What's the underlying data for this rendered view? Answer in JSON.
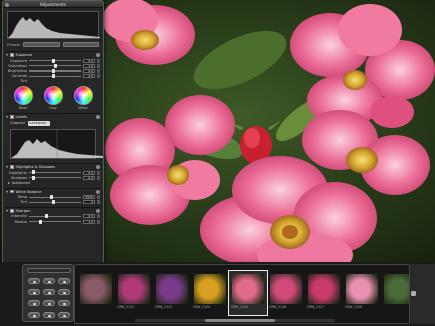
{
  "hud": {
    "title": "Adjustments",
    "preset_label": "Presets",
    "exposure": {
      "title": "Exposure",
      "rows": [
        {
          "name": "Exposure",
          "value": "0.0"
        },
        {
          "name": "Saturation",
          "value": "1.0"
        },
        {
          "name": "Brightness",
          "value": "0.0"
        },
        {
          "name": "Contrast",
          "value": "0.0"
        }
      ],
      "tint_label": "Tint",
      "wheels": [
        "Black",
        "Gray",
        "White"
      ]
    },
    "levels": {
      "title": "Levels",
      "channel_label": "Channel",
      "channel_value": "Luminance"
    },
    "highlights": {
      "title": "Highlights & Shadows",
      "rows": [
        {
          "name": "Highlights",
          "value": "0.0"
        },
        {
          "name": "Shadows",
          "value": "0.0"
        }
      ],
      "advanced_label": "Advanced"
    },
    "white_balance": {
      "title": "White Balance",
      "rows": [
        {
          "name": "Temp",
          "value": "5000"
        },
        {
          "name": "Tint",
          "value": "0"
        }
      ]
    },
    "sharpen": {
      "title": "Sharpen",
      "rows": [
        {
          "name": "Intensity",
          "value": "0.5"
        },
        {
          "name": "Radius",
          "value": "1.0"
        }
      ]
    }
  },
  "filmstrip": {
    "thumbs": [
      {
        "caption": "",
        "color": "#8a5a6a"
      },
      {
        "caption": "CRW_2122",
        "color": "#b03a7a"
      },
      {
        "caption": "CRW_2123",
        "color": "#7a3a8a"
      },
      {
        "caption": "CRW_2124",
        "color": "#d8a020"
      },
      {
        "caption": "CRW_2125",
        "color": "#e06a8a"
      },
      {
        "caption": "CRW_2126",
        "color": "#d04a7a"
      },
      {
        "caption": "CRW_2127",
        "color": "#c83a6a"
      },
      {
        "caption": "CRW_2128",
        "color": "#e890b0"
      },
      {
        "caption": "",
        "color": "#4a6a3a"
      }
    ],
    "selected_index": 4
  },
  "colors": {
    "petal": "#e8608a",
    "petal_light": "#f39ab8",
    "center": "#e8c038",
    "foliage": "#3c5a24"
  }
}
